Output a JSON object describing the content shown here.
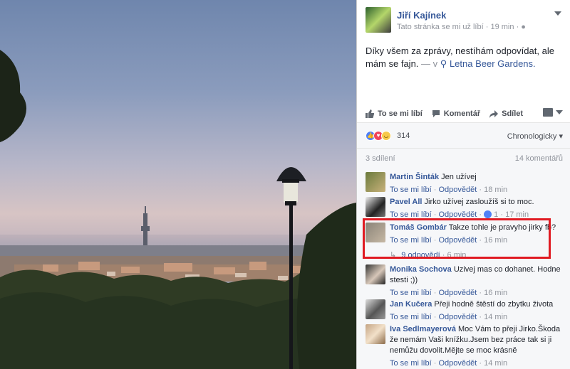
{
  "post": {
    "author": "Jiří Kajínek",
    "meta_text": "Tato stránka se mi už líbí",
    "time": "19 min",
    "text": "Díky všem za zprávy, nestíhám odpovídat, ale mám se fajn.",
    "with": "— v",
    "location": "Letna Beer Gardens."
  },
  "actions": {
    "like": "To se mi líbí",
    "comment": "Komentář",
    "share": "Sdílet"
  },
  "reactions": {
    "count": "314",
    "sort": "Chronologicky"
  },
  "stats": {
    "shares": "3 sdílení",
    "comments": "14 komentářů"
  },
  "link_labels": {
    "like": "To se mi líbí",
    "reply": "Odpovědět",
    "sep": "·"
  },
  "comments": [
    {
      "name": "Martin Šinták",
      "text": "Jen užívej",
      "time": "18 min"
    },
    {
      "name": "Pavel All",
      "text": "Jirko užívej zasloužíš si to moc.",
      "likes": "1",
      "time": "17 min"
    },
    {
      "name": "Tomáš Gombár",
      "text": "Takze tohle je pravyho jirky fb?",
      "time": "16 min",
      "replies": "9 odpovědí",
      "replies_time": "6 min"
    },
    {
      "name": "Monika Sochova",
      "text": "Uzivej mas co dohanet. Hodne stesti ;))",
      "time": "16 min"
    },
    {
      "name": "Jan Kučera",
      "text": "Přeji hodně štěstí do zbytku života",
      "time": "14 min"
    },
    {
      "name": "Iva Sedlmayerová",
      "text": "Moc Vám to přeji Jirko.Škoda že nemám Vaši knížku.Jsem bez práce tak si ji nemůžu dovolit.Mějte se moc krásně",
      "time": "14 min"
    }
  ],
  "colors": {
    "link": "#365899",
    "highlight": "#e01a22",
    "panel_bg": "#f6f7f9"
  }
}
